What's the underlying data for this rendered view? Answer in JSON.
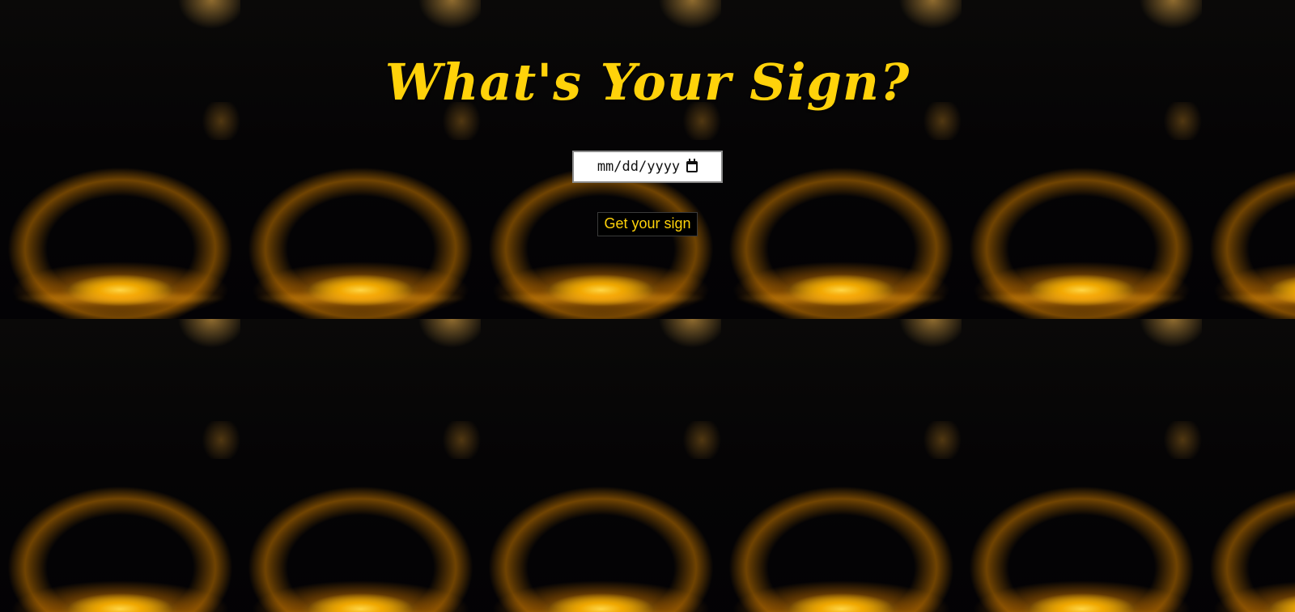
{
  "page": {
    "title": "What's Your Sign?"
  },
  "form": {
    "date_placeholder": "mm/dd/yyyy",
    "submit_label": "Get your sign"
  },
  "icons": {
    "date_picker": "calendar-icon"
  },
  "colors": {
    "accent": "#ffd20a",
    "background": "#020208",
    "button_background": "#000000"
  }
}
